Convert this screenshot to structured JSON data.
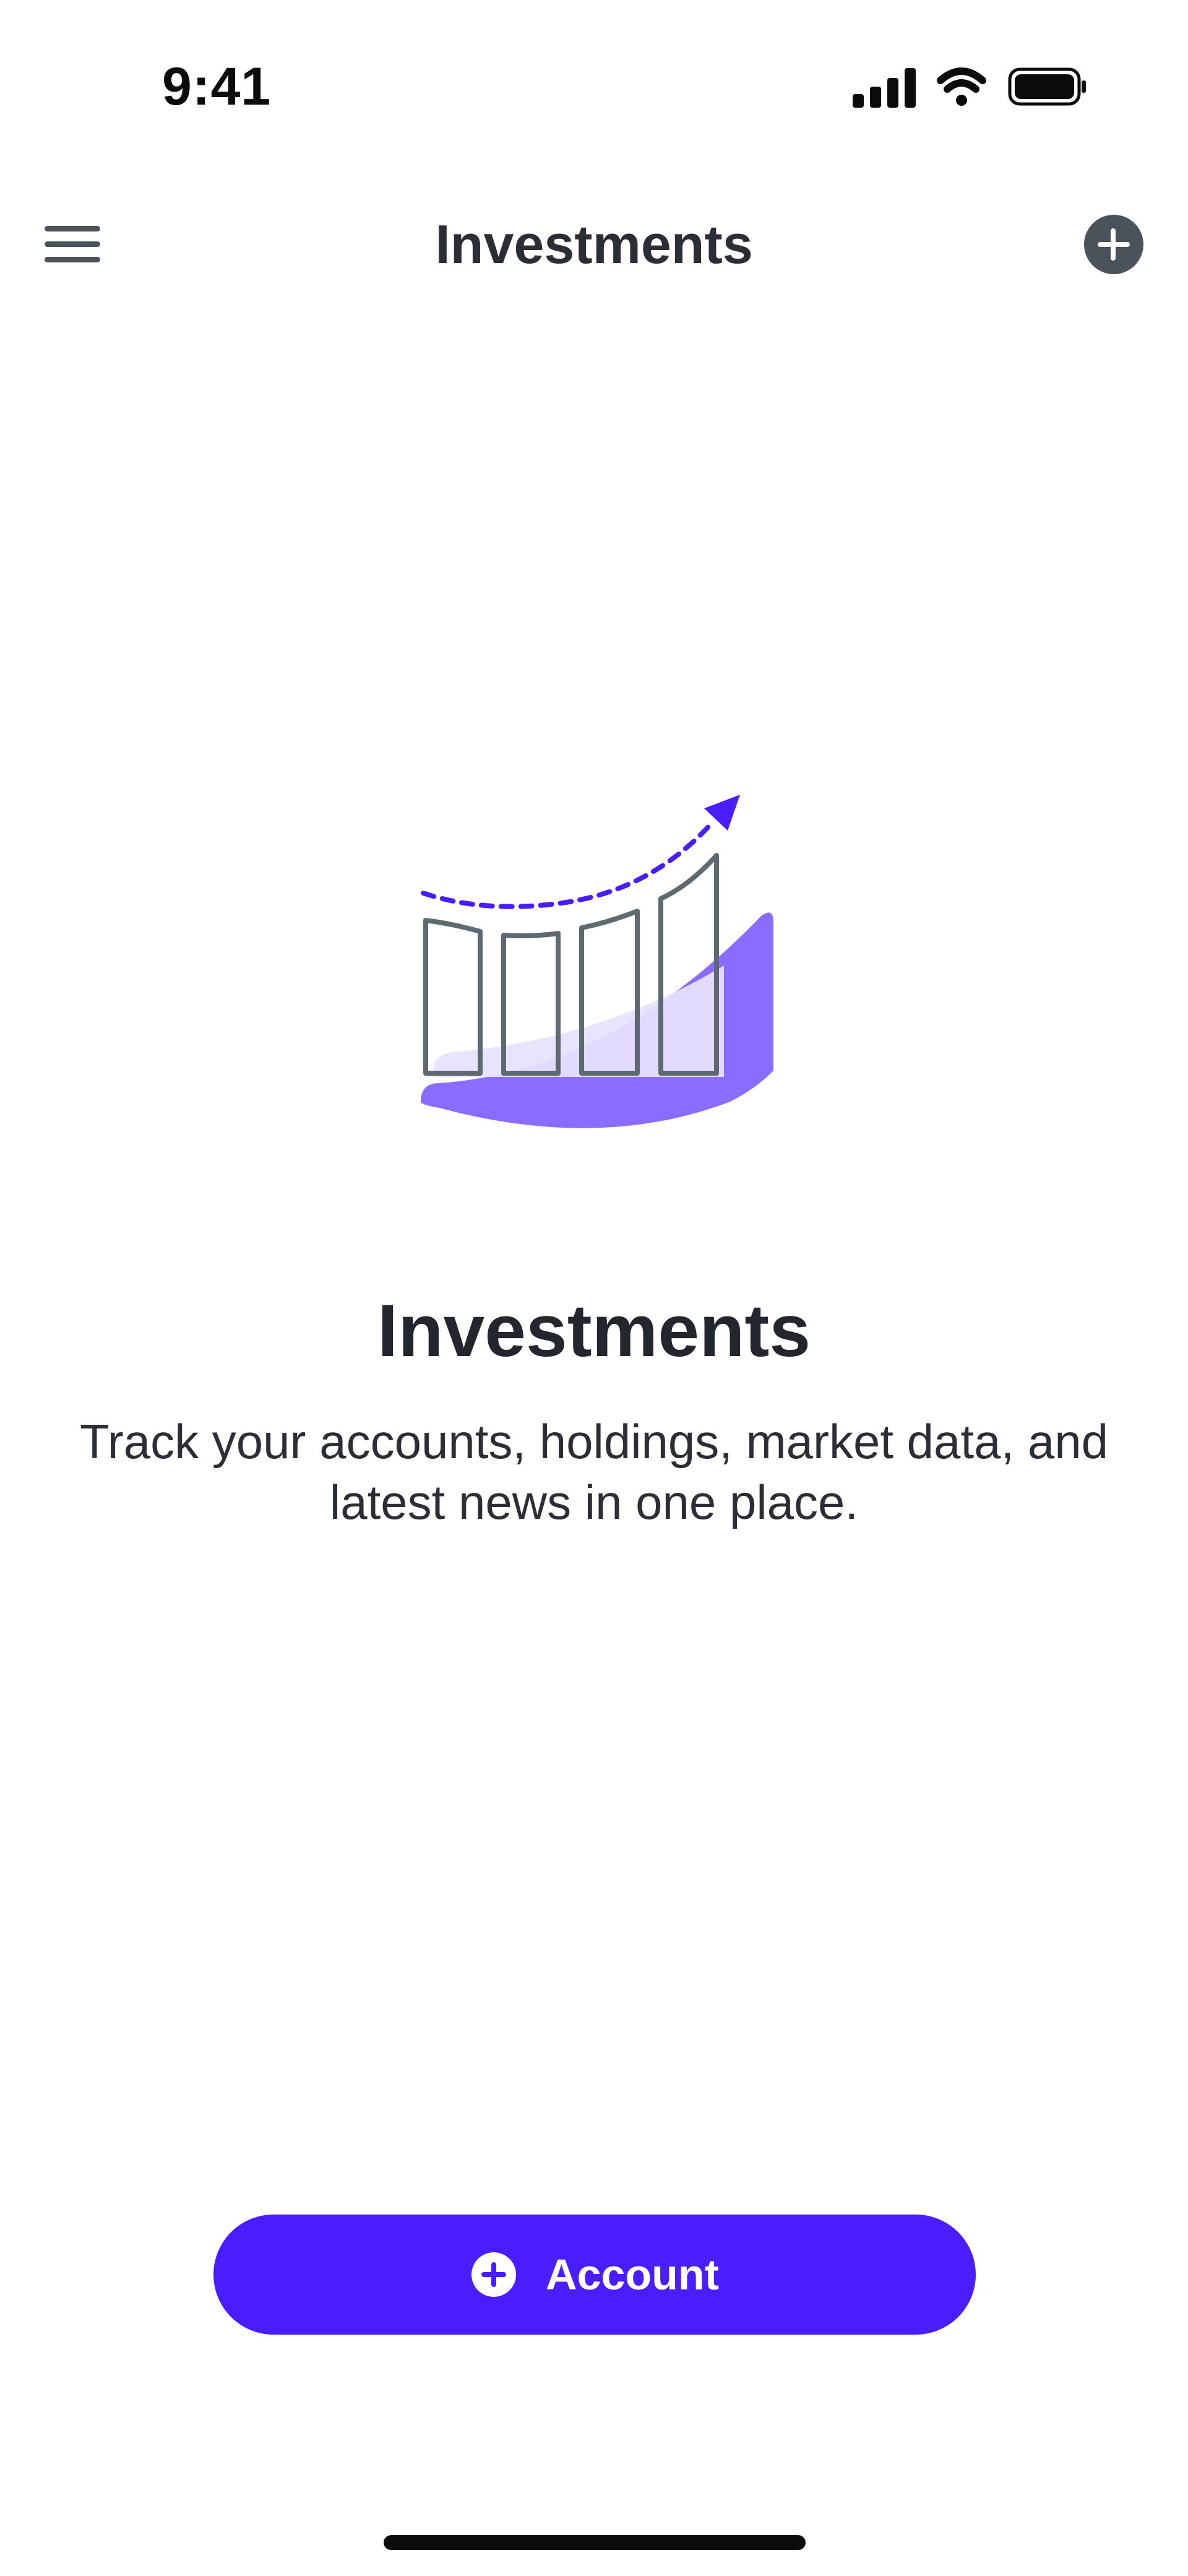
{
  "status_bar": {
    "time": "9:41",
    "icons": [
      "cellular-signal-icon",
      "wifi-icon",
      "battery-icon"
    ]
  },
  "nav_bar": {
    "title": "Investments",
    "menu_icon": "hamburger-menu-icon",
    "action_icon": "plus-circle-icon"
  },
  "empty_state": {
    "illustration_icon": "growth-bar-chart-icon",
    "title": "Investments",
    "description": "Track your accounts, holdings, market data, and latest news in one place."
  },
  "cta": {
    "label": "Account",
    "icon": "plus-circle-icon"
  },
  "colors": {
    "accent": "#4a1dff",
    "illustration_fill": "#8a6dff",
    "illustration_light": "#e7e1ff",
    "illustration_stroke": "#5d6a70",
    "nav_icon": "#4b535a",
    "text_primary": "#23262d",
    "background": "#ffffff"
  }
}
